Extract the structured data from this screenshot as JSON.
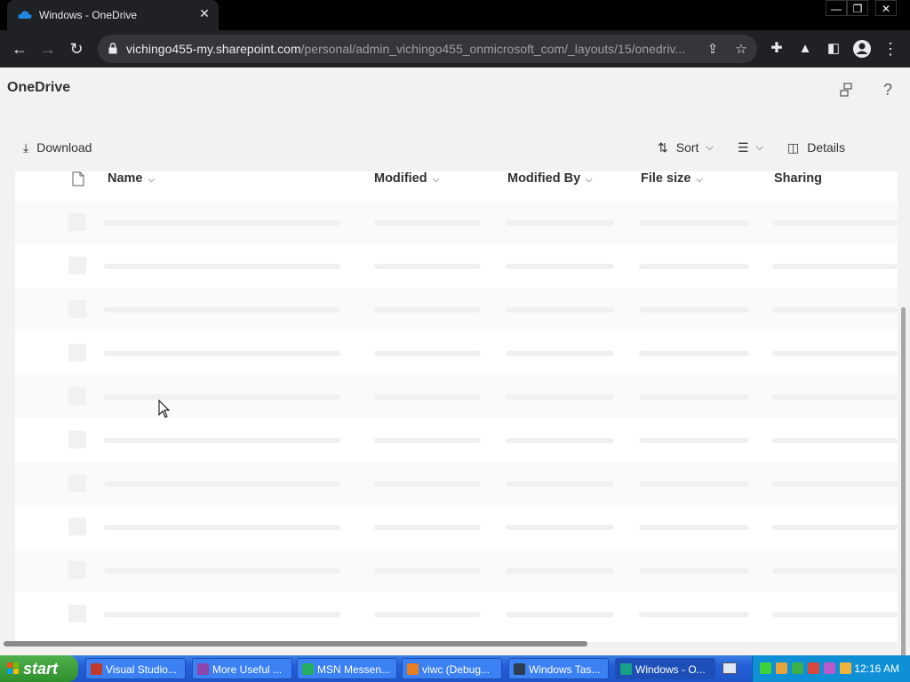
{
  "browser": {
    "tab_title": "Windows - OneDrive",
    "tab_close": "✕",
    "url_host": "vichingo455-my.sharepoint.com",
    "url_path": "/personal/admin_vichingo455_onmicrosoft_com/_layouts/15/onedriv...",
    "window_controls": {
      "minimize": "—",
      "restore": "❐",
      "close": "✕"
    }
  },
  "app": {
    "title": "OneDrive"
  },
  "commands": {
    "download": "Download",
    "sort": "Sort",
    "details": "Details"
  },
  "columns": [
    {
      "label": "Name"
    },
    {
      "label": "Modified"
    },
    {
      "label": "Modified By"
    },
    {
      "label": "File size"
    },
    {
      "label": "Sharing"
    }
  ],
  "list_state": "loading-placeholders",
  "taskbar": {
    "start_label": "start",
    "tasks": [
      {
        "label": "Visual Studio...",
        "color": "#c0392b"
      },
      {
        "label": "More Useful ...",
        "color": "#8e44ad"
      },
      {
        "label": "MSN Messen...",
        "color": "#27ae60"
      },
      {
        "label": "viwc (Debug...",
        "color": "#e67e22"
      },
      {
        "label": "Windows Tas...",
        "color": "#2c3e50"
      },
      {
        "label": "Windows - O...",
        "color": "#16a085"
      }
    ],
    "clock": "12:16 AM"
  },
  "colors": {
    "chrome_bg": "#202124",
    "page_bg": "#f3f2f1",
    "taskbar_blue": "#245edb",
    "start_green": "#2f8f2d",
    "tray_blue": "#0f8fd6"
  }
}
